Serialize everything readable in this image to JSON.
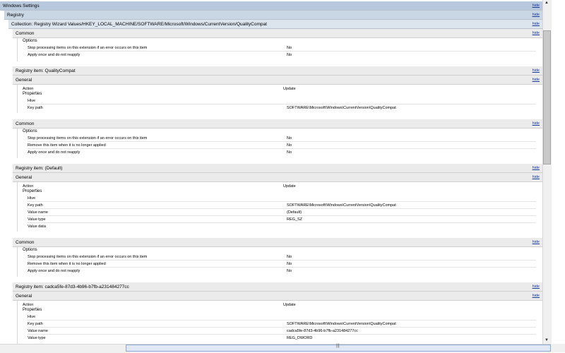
{
  "hide_label": "hide",
  "headers": {
    "windows_settings": "Windows Settings",
    "registry": "Registry",
    "collection": "Collection: Registry Wizard Values/HKEY_LOCAL_MACHINE/SOFTWARE/Microsoft/Windows/CurrentVersion/QualityCompat",
    "common": "Common",
    "general": "General",
    "item_qualitycompat": "Registry item: QualityCompat",
    "item_default": "Registry item: (Default)",
    "item_guid": "Registry item: cadca5fe-87d3-4b96-b7fb-a231484277cc"
  },
  "labels": {
    "options": "Options",
    "properties": "Properties",
    "action": "Action",
    "hive": "Hive",
    "key_path": "Key path",
    "value_name": "Value name",
    "value_type": "Value type",
    "value_data": "Value data",
    "stop_processing": "Stop processing items on this extension if an error occurs on this item",
    "remove_item": "Remove this item when it is no longer applied",
    "apply_once": "Apply once and do not reapply"
  },
  "values": {
    "no": "No",
    "update": "Update",
    "key_path": "SOFTWARE\\Microsoft\\Windows\\CurrentVersion\\QualityCompat",
    "default_name": "(Default)",
    "reg_sz": "REG_SZ",
    "guid_name": "cadca5fe-87d3-4b96-b7fb-a231484277cc",
    "reg_dword": "REG_DWORD"
  },
  "scroll_grip": "|||"
}
